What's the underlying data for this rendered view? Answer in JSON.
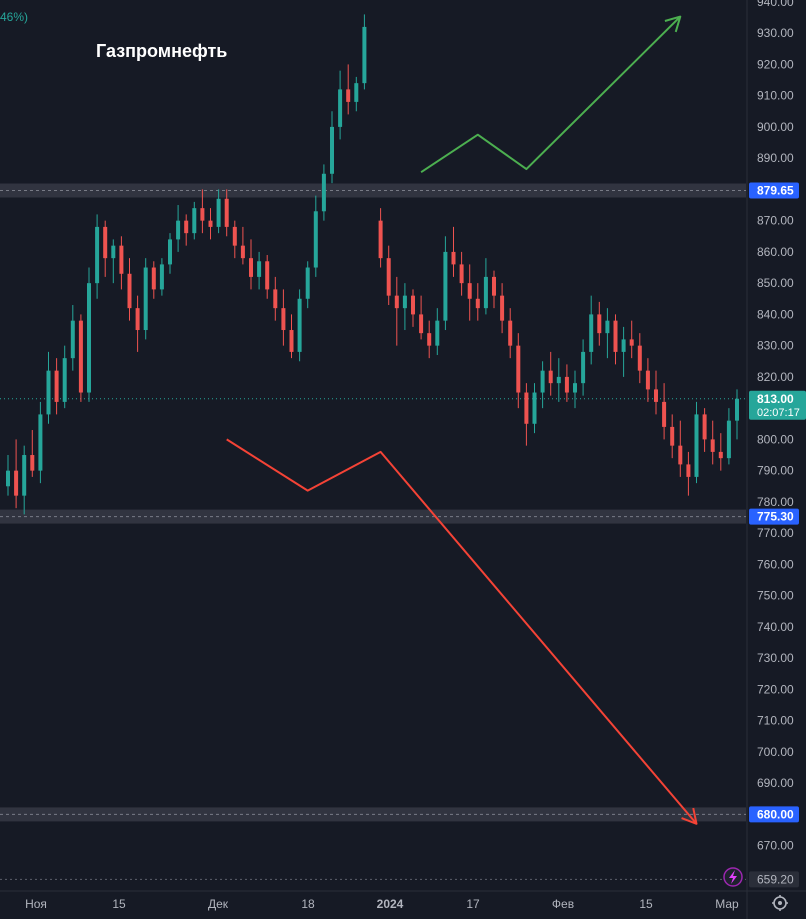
{
  "chart_data": {
    "type": "candlestick",
    "title": "Газпромнефть",
    "top_left_fragment": "46%)",
    "ylim": [
      656,
      940
    ],
    "y_ticks": [
      940,
      930,
      920,
      910,
      900,
      890,
      870,
      860,
      850,
      840,
      830,
      820,
      800,
      790,
      780,
      770,
      760,
      750,
      740,
      730,
      720,
      710,
      700,
      690,
      670
    ],
    "x_ticks": [
      {
        "label": "Ноя",
        "bold": false
      },
      {
        "label": "15",
        "bold": false
      },
      {
        "label": "Дек",
        "bold": false
      },
      {
        "label": "18",
        "bold": false
      },
      {
        "label": "2024",
        "bold": true
      },
      {
        "label": "17",
        "bold": false
      },
      {
        "label": "Фев",
        "bold": false
      },
      {
        "label": "15",
        "bold": false
      },
      {
        "label": "Мар",
        "bold": false
      }
    ],
    "levels": [
      {
        "label": "879.65",
        "value": 879.65
      },
      {
        "label": "775.30",
        "value": 775.3
      },
      {
        "label": "680.00",
        "value": 680.0
      }
    ],
    "current_price": {
      "label": "813.00",
      "value": 813.0,
      "countdown": "02:07:17"
    },
    "low_marker": {
      "label": "659.20",
      "value": 659.2
    },
    "candles": [
      {
        "o": 785,
        "h": 795,
        "l": 782,
        "c": 790
      },
      {
        "o": 790,
        "h": 800,
        "l": 778,
        "c": 782
      },
      {
        "o": 782,
        "h": 798,
        "l": 776,
        "c": 795
      },
      {
        "o": 795,
        "h": 803,
        "l": 788,
        "c": 790
      },
      {
        "o": 790,
        "h": 812,
        "l": 786,
        "c": 808
      },
      {
        "o": 808,
        "h": 828,
        "l": 805,
        "c": 822
      },
      {
        "o": 822,
        "h": 826,
        "l": 808,
        "c": 812
      },
      {
        "o": 812,
        "h": 830,
        "l": 810,
        "c": 826
      },
      {
        "o": 826,
        "h": 843,
        "l": 822,
        "c": 838
      },
      {
        "o": 838,
        "h": 840,
        "l": 812,
        "c": 815
      },
      {
        "o": 815,
        "h": 855,
        "l": 812,
        "c": 850
      },
      {
        "o": 850,
        "h": 872,
        "l": 845,
        "c": 868
      },
      {
        "o": 868,
        "h": 870,
        "l": 852,
        "c": 858
      },
      {
        "o": 858,
        "h": 864,
        "l": 850,
        "c": 862
      },
      {
        "o": 862,
        "h": 865,
        "l": 848,
        "c": 853
      },
      {
        "o": 853,
        "h": 858,
        "l": 838,
        "c": 842
      },
      {
        "o": 842,
        "h": 846,
        "l": 828,
        "c": 835
      },
      {
        "o": 835,
        "h": 858,
        "l": 832,
        "c": 855
      },
      {
        "o": 855,
        "h": 857,
        "l": 845,
        "c": 848
      },
      {
        "o": 848,
        "h": 858,
        "l": 846,
        "c": 856
      },
      {
        "o": 856,
        "h": 866,
        "l": 853,
        "c": 864
      },
      {
        "o": 864,
        "h": 875,
        "l": 860,
        "c": 870
      },
      {
        "o": 870,
        "h": 872,
        "l": 862,
        "c": 866
      },
      {
        "o": 866,
        "h": 876,
        "l": 864,
        "c": 874
      },
      {
        "o": 874,
        "h": 880,
        "l": 866,
        "c": 870
      },
      {
        "o": 870,
        "h": 874,
        "l": 864,
        "c": 868
      },
      {
        "o": 868,
        "h": 880,
        "l": 866,
        "c": 877
      },
      {
        "o": 877,
        "h": 880,
        "l": 865,
        "c": 868
      },
      {
        "o": 868,
        "h": 870,
        "l": 858,
        "c": 862
      },
      {
        "o": 862,
        "h": 868,
        "l": 856,
        "c": 858
      },
      {
        "o": 858,
        "h": 864,
        "l": 848,
        "c": 852
      },
      {
        "o": 852,
        "h": 860,
        "l": 848,
        "c": 857
      },
      {
        "o": 857,
        "h": 859,
        "l": 845,
        "c": 848
      },
      {
        "o": 848,
        "h": 852,
        "l": 838,
        "c": 842
      },
      {
        "o": 842,
        "h": 848,
        "l": 830,
        "c": 835
      },
      {
        "o": 835,
        "h": 840,
        "l": 826,
        "c": 828
      },
      {
        "o": 828,
        "h": 848,
        "l": 825,
        "c": 845
      },
      {
        "o": 845,
        "h": 857,
        "l": 842,
        "c": 855
      },
      {
        "o": 855,
        "h": 878,
        "l": 852,
        "c": 873
      },
      {
        "o": 873,
        "h": 888,
        "l": 870,
        "c": 885
      },
      {
        "o": 885,
        "h": 905,
        "l": 882,
        "c": 900
      },
      {
        "o": 900,
        "h": 918,
        "l": 896,
        "c": 912
      },
      {
        "o": 912,
        "h": 920,
        "l": 904,
        "c": 908
      },
      {
        "o": 908,
        "h": 916,
        "l": 905,
        "c": 914
      },
      {
        "o": 914,
        "h": 936,
        "l": 912,
        "c": 932
      },
      {
        "o": 870,
        "h": 874,
        "l": 855,
        "c": 858
      },
      {
        "o": 858,
        "h": 862,
        "l": 843,
        "c": 846
      },
      {
        "o": 846,
        "h": 852,
        "l": 830,
        "c": 842
      },
      {
        "o": 842,
        "h": 850,
        "l": 835,
        "c": 846
      },
      {
        "o": 846,
        "h": 848,
        "l": 836,
        "c": 840
      },
      {
        "o": 840,
        "h": 846,
        "l": 832,
        "c": 834
      },
      {
        "o": 834,
        "h": 838,
        "l": 826,
        "c": 830
      },
      {
        "o": 830,
        "h": 842,
        "l": 827,
        "c": 838
      },
      {
        "o": 838,
        "h": 865,
        "l": 835,
        "c": 860
      },
      {
        "o": 860,
        "h": 868,
        "l": 852,
        "c": 856
      },
      {
        "o": 856,
        "h": 860,
        "l": 846,
        "c": 850
      },
      {
        "o": 850,
        "h": 856,
        "l": 838,
        "c": 845
      },
      {
        "o": 845,
        "h": 850,
        "l": 838,
        "c": 842
      },
      {
        "o": 842,
        "h": 858,
        "l": 840,
        "c": 852
      },
      {
        "o": 852,
        "h": 854,
        "l": 842,
        "c": 846
      },
      {
        "o": 846,
        "h": 850,
        "l": 834,
        "c": 838
      },
      {
        "o": 838,
        "h": 842,
        "l": 826,
        "c": 830
      },
      {
        "o": 830,
        "h": 834,
        "l": 810,
        "c": 815
      },
      {
        "o": 815,
        "h": 818,
        "l": 798,
        "c": 805
      },
      {
        "o": 805,
        "h": 818,
        "l": 802,
        "c": 815
      },
      {
        "o": 815,
        "h": 825,
        "l": 810,
        "c": 822
      },
      {
        "o": 822,
        "h": 828,
        "l": 814,
        "c": 818
      },
      {
        "o": 818,
        "h": 826,
        "l": 812,
        "c": 820
      },
      {
        "o": 820,
        "h": 824,
        "l": 812,
        "c": 815
      },
      {
        "o": 815,
        "h": 822,
        "l": 810,
        "c": 818
      },
      {
        "o": 818,
        "h": 832,
        "l": 814,
        "c": 828
      },
      {
        "o": 828,
        "h": 846,
        "l": 824,
        "c": 840
      },
      {
        "o": 840,
        "h": 844,
        "l": 830,
        "c": 834
      },
      {
        "o": 834,
        "h": 842,
        "l": 826,
        "c": 838
      },
      {
        "o": 838,
        "h": 840,
        "l": 824,
        "c": 828
      },
      {
        "o": 828,
        "h": 836,
        "l": 820,
        "c": 832
      },
      {
        "o": 832,
        "h": 838,
        "l": 826,
        "c": 830
      },
      {
        "o": 830,
        "h": 834,
        "l": 818,
        "c": 822
      },
      {
        "o": 822,
        "h": 826,
        "l": 812,
        "c": 816
      },
      {
        "o": 816,
        "h": 822,
        "l": 808,
        "c": 812
      },
      {
        "o": 812,
        "h": 818,
        "l": 800,
        "c": 804
      },
      {
        "o": 804,
        "h": 808,
        "l": 794,
        "c": 798
      },
      {
        "o": 798,
        "h": 806,
        "l": 788,
        "c": 792
      },
      {
        "o": 792,
        "h": 796,
        "l": 782,
        "c": 788
      },
      {
        "o": 788,
        "h": 812,
        "l": 786,
        "c": 808
      },
      {
        "o": 808,
        "h": 810,
        "l": 796,
        "c": 800
      },
      {
        "o": 800,
        "h": 806,
        "l": 792,
        "c": 796
      },
      {
        "o": 796,
        "h": 802,
        "l": 790,
        "c": 794
      },
      {
        "o": 794,
        "h": 810,
        "l": 792,
        "c": 806
      },
      {
        "o": 806,
        "h": 816,
        "l": 800,
        "c": 813
      }
    ],
    "arrows": [
      {
        "color": "#4caf50",
        "points": [
          [
            6,
            885.5
          ],
          [
            13,
            897.5
          ],
          [
            19,
            886.5
          ],
          [
            38,
            935.3
          ]
        ]
      },
      {
        "color": "#f44336",
        "points": [
          [
            -18,
            800
          ],
          [
            -8,
            783.6
          ],
          [
            1,
            796
          ],
          [
            40,
            677
          ]
        ]
      }
    ]
  }
}
